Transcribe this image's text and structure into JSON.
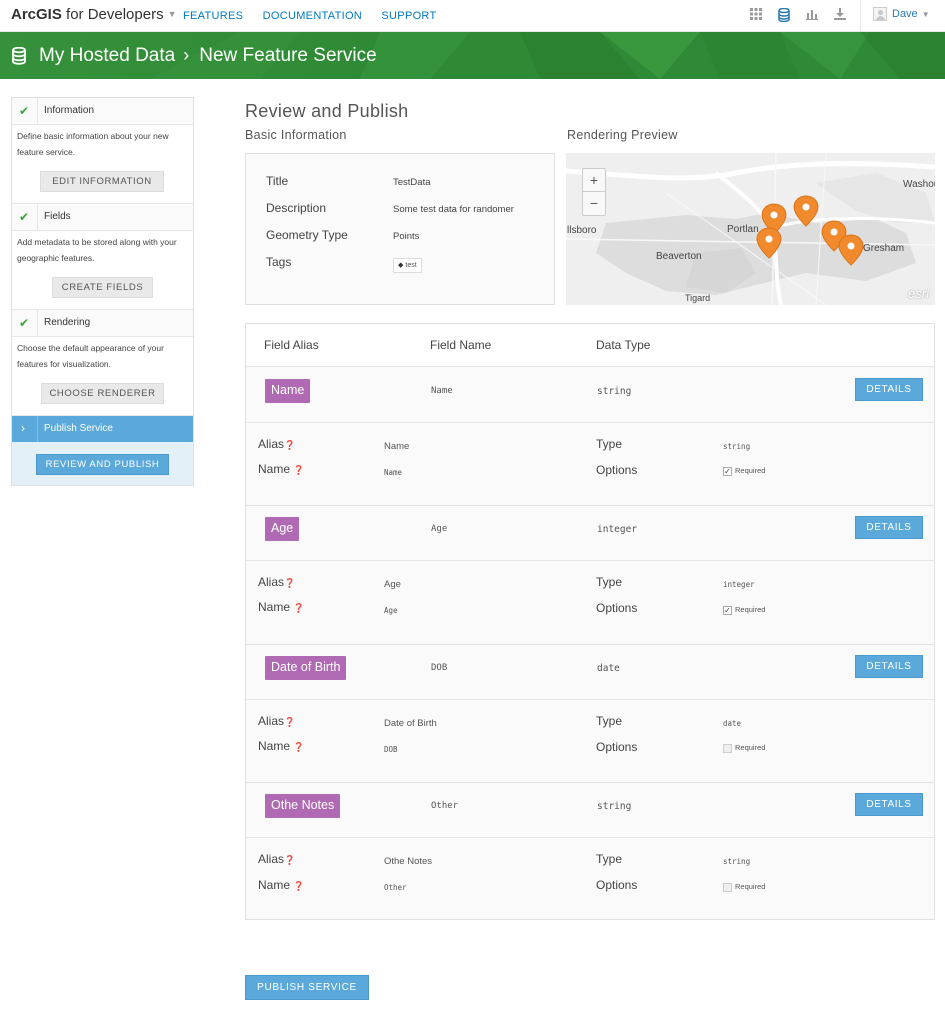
{
  "topnav": {
    "brand_strong": "ArcGIS",
    "brand_rest": " for Developers",
    "links": [
      "FEATURES",
      "DOCUMENTATION",
      "SUPPORT"
    ],
    "icons": [
      "grid-icon",
      "database-icon",
      "chart-icon",
      "download-icon"
    ],
    "user": "Dave"
  },
  "banner": {
    "crumb_1": "My Hosted Data",
    "crumb_2": "New Feature Service"
  },
  "sidebar": {
    "steps": [
      {
        "label": "Information",
        "desc": "Define basic information about your new feature service.",
        "button": "EDIT INFORMATION"
      },
      {
        "label": "Fields",
        "desc": "Add metadata to be stored along with your geographic features.",
        "button": "CREATE FIELDS"
      },
      {
        "label": "Rendering",
        "desc": "Choose the default appearance of your features for visualization.",
        "button": "CHOOSE RENDERER"
      }
    ],
    "active_step": {
      "label": "Publish Service",
      "button": "REVIEW AND PUBLISH"
    }
  },
  "main": {
    "heading": "Review and Publish",
    "basic_info_heading": "Basic Information",
    "preview_heading": "Rendering Preview",
    "info": {
      "title_label": "Title",
      "title_value": "TestData",
      "description_label": "Description",
      "description_value": "Some test data for randomer",
      "geometry_label": "Geometry Type",
      "geometry_value": "Points",
      "tags_label": "Tags",
      "tag": "test"
    },
    "map": {
      "zoom_in": "+",
      "zoom_out": "−",
      "labels": [
        "Washou",
        "llsboro",
        "Portlan",
        "Gresham",
        "Beaverton",
        "Tigard"
      ],
      "attribution": "esri"
    },
    "fields_header": {
      "alias": "Field Alias",
      "name": "Field Name",
      "type": "Data Type"
    },
    "field_labels": {
      "alias": "Alias",
      "name": "Name",
      "type": "Type",
      "options": "Options",
      "required": "Required",
      "details": "DETAILS",
      "help": "?"
    },
    "fields": [
      {
        "alias": "Name",
        "name": "Name",
        "type": "string",
        "required": true
      },
      {
        "alias": "Age",
        "name": "Age",
        "type": "integer",
        "required": true
      },
      {
        "alias": "Date of Birth",
        "name": "DOB",
        "type": "date",
        "required": false
      },
      {
        "alias": "Othe Notes",
        "name": "Other",
        "type": "string",
        "required": false
      }
    ],
    "publish_button": "PUBLISH SERVICE"
  },
  "colors": {
    "accent": "#5ba9db",
    "banner_green": "#2f8a35",
    "field_badge": "#b06ab3",
    "marker": "#f08a2c",
    "check": "#3aa23a"
  }
}
